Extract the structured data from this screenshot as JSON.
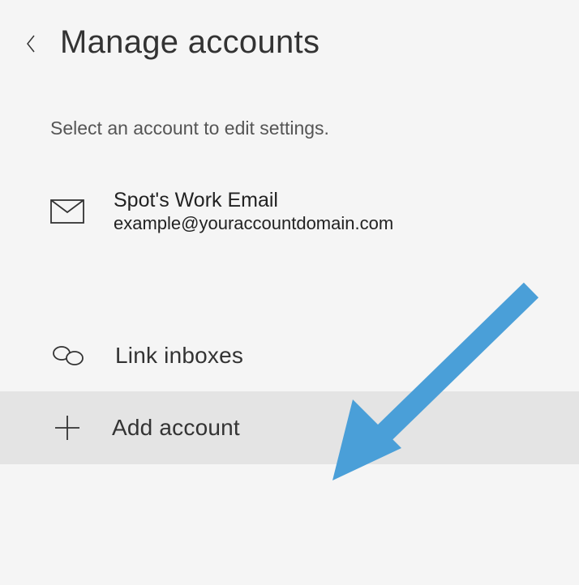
{
  "header": {
    "title": "Manage accounts"
  },
  "subtitle": "Select an account to edit settings.",
  "account": {
    "name": "Spot's Work Email",
    "email": "example@youraccountdomain.com"
  },
  "actions": {
    "link_inboxes": "Link inboxes",
    "add_account": "Add account"
  },
  "colors": {
    "arrow": "#4a9fd8"
  }
}
